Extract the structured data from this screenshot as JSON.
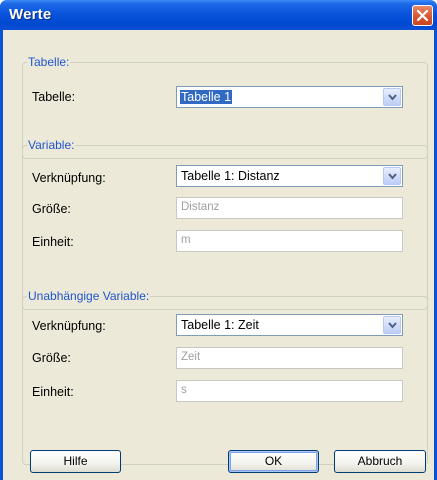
{
  "window": {
    "title": "Werte"
  },
  "groups": {
    "tabelle": {
      "legend": "Tabelle:",
      "label": "Tabelle:",
      "select_value": "Tabelle 1"
    },
    "variable": {
      "legend": "Variable:",
      "link_label": "Verknüpfung:",
      "link_value": "Tabelle 1: Distanz",
      "size_label": "Größe:",
      "size_placeholder": "Distanz",
      "unit_label": "Einheit:",
      "unit_placeholder": "m"
    },
    "independent": {
      "legend": "Unabhängige Variable:",
      "link_label": "Verknüpfung:",
      "link_value": "Tabelle 1: Zeit",
      "size_label": "Größe:",
      "size_placeholder": "Zeit",
      "unit_label": "Einheit:",
      "unit_placeholder": "s"
    }
  },
  "buttons": {
    "help": "Hilfe",
    "ok": "OK",
    "cancel": "Abbruch"
  },
  "icons": {
    "close": "close-icon",
    "dropdown": "chevron-down-icon"
  },
  "colors": {
    "titlebar": "#0a55dc",
    "legend_text": "#1f55cf",
    "selection": "#316ac5",
    "close_button": "#d95a35"
  }
}
